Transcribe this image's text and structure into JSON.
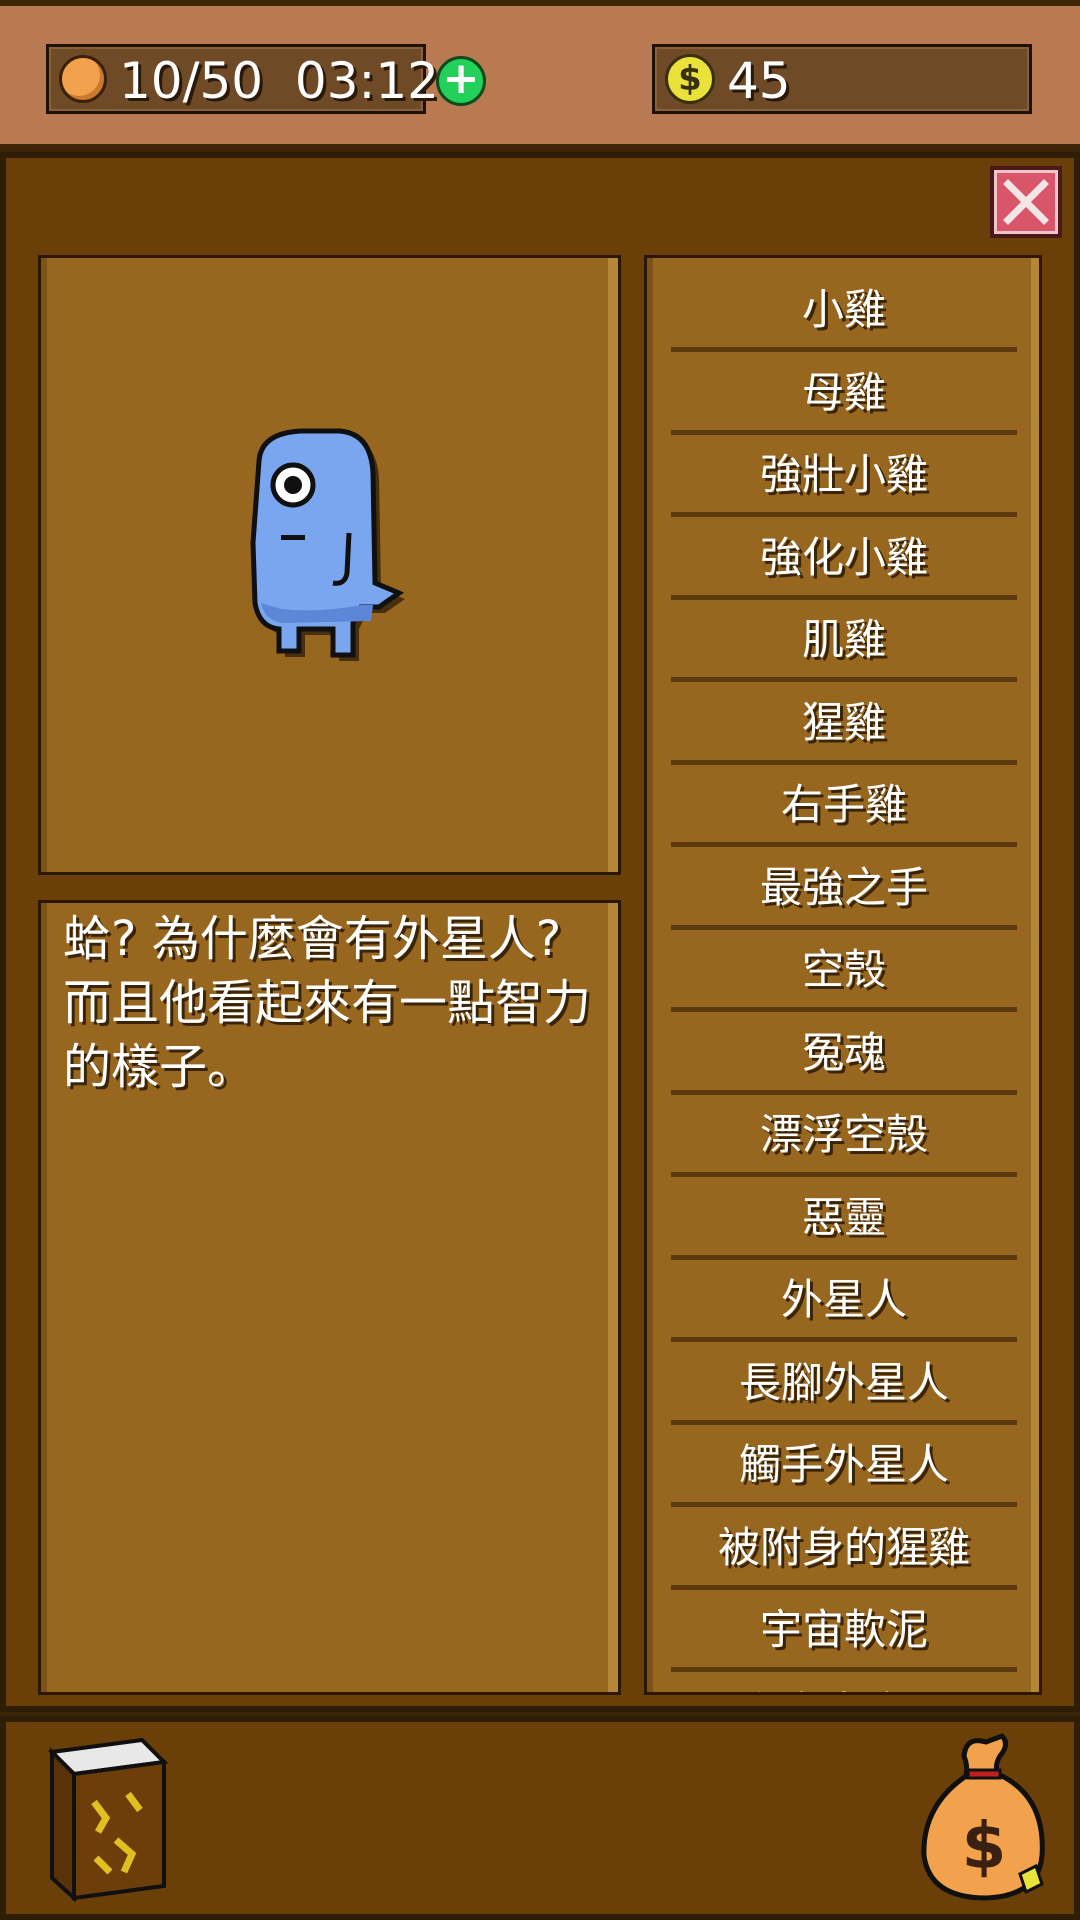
{
  "hud": {
    "energy_text": "10/50  03:12",
    "plus_label": "+",
    "coin_count": "45",
    "dollar_symbol": "$"
  },
  "detail": {
    "description": "蛤? 為什麼會有外星人? 而且他看起來有一點智力的樣子。"
  },
  "list": {
    "items": [
      "小雞",
      "母雞",
      "強壯小雞",
      "強化小雞",
      "肌雞",
      "猩雞",
      "右手雞",
      "最強之手",
      "空殼",
      "冤魂",
      "漂浮空殼",
      "惡靈",
      "外星人",
      "長腳外星人",
      "觸手外星人",
      "被附身的猩雞",
      "宇宙軟泥",
      "宇宙大魔王"
    ]
  },
  "colors": {
    "panel": "#6a4008",
    "card": "#98671f",
    "topbar": "#b97a52",
    "creature": "#7aa6f0",
    "close_button": "#d9566a",
    "plus_button": "#22d05a"
  },
  "icons": {
    "energy": "cookie-icon",
    "currency": "dollar-coin-icon",
    "close": "close-icon",
    "book": "spellbook-icon",
    "bag": "money-bag-icon"
  }
}
